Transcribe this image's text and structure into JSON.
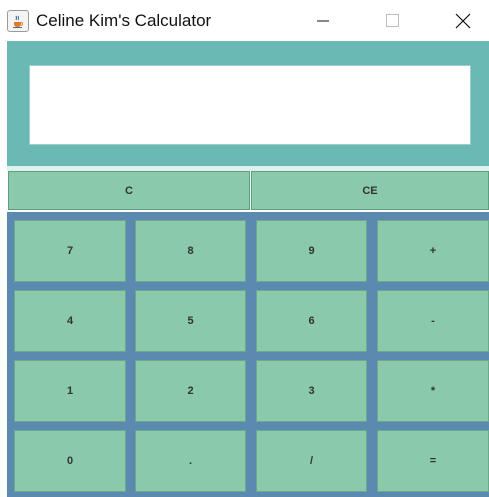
{
  "window": {
    "title": "Celine Kim's Calculator",
    "icon": "java-coffee-cup-icon",
    "controls": [
      "minimize-icon",
      "maximize-icon",
      "close-icon"
    ]
  },
  "display": {
    "value": ""
  },
  "clear_buttons": {
    "clear_label": "C",
    "clear_entry_label": "CE"
  },
  "keys": {
    "row1": [
      "7",
      "8",
      "9",
      "+"
    ],
    "row2": [
      "4",
      "5",
      "6",
      "-"
    ],
    "row3": [
      "1",
      "2",
      "3",
      "*"
    ],
    "row4": [
      "0",
      ".",
      "/",
      "="
    ]
  },
  "colors": {
    "display_panel": "#6bb9b4",
    "button_face": "#8ac9a9",
    "keypad_background": "#5b89b0"
  }
}
